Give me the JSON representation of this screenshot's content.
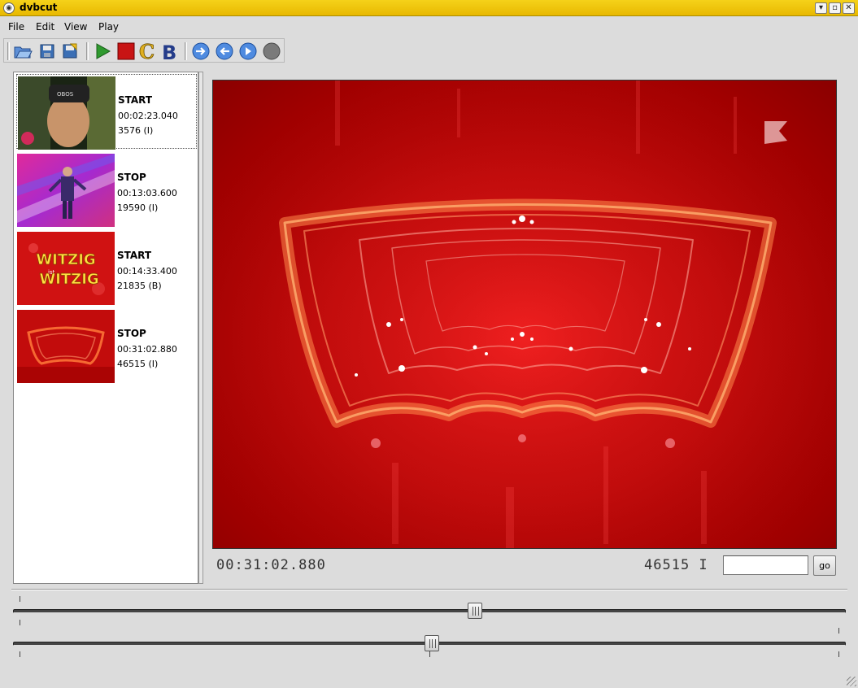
{
  "window": {
    "title": "dvbcut",
    "app_icon": "app-icon",
    "buttons": [
      "minimize-icon",
      "maximize-icon",
      "close-icon"
    ]
  },
  "menubar": {
    "items": [
      {
        "label": "File"
      },
      {
        "label": "Edit"
      },
      {
        "label": "View"
      },
      {
        "label": "Play"
      }
    ]
  },
  "toolbar": {
    "buttons": [
      {
        "name": "open",
        "icon": "open-folder-icon"
      },
      {
        "name": "save",
        "icon": "save-icon"
      },
      {
        "name": "export",
        "icon": "export-icon"
      },
      {
        "name": "play",
        "icon": "play-icon"
      },
      {
        "name": "stop",
        "icon": "stop-icon"
      },
      {
        "name": "chapter",
        "icon": "chapter-c-icon",
        "glyph": "C"
      },
      {
        "name": "bookmark",
        "icon": "bookmark-b-icon",
        "glyph": "B"
      },
      {
        "name": "jump-forward",
        "icon": "arrow-right-circle-icon"
      },
      {
        "name": "jump-back",
        "icon": "arrow-left-circle-icon"
      },
      {
        "name": "next",
        "icon": "triangle-right-circle-icon"
      },
      {
        "name": "record",
        "icon": "gray-circle-icon"
      }
    ]
  },
  "marks": [
    {
      "kind": "START",
      "time": "00:02:23.040",
      "frame": "3576 (I)",
      "selected": true
    },
    {
      "kind": "STOP",
      "time": "00:13:03.600",
      "frame": "19590 (I)",
      "selected": false
    },
    {
      "kind": "START",
      "time": "00:14:33.400",
      "frame": "21835 (B)",
      "selected": false
    },
    {
      "kind": "STOP",
      "time": "00:31:02.880",
      "frame": "46515 (I)",
      "selected": false
    }
  ],
  "thumb3_text": {
    "line1": "WITZIG",
    "line2": "ist",
    "line3": "WITZIG"
  },
  "status": {
    "timecode": "00:31:02.880",
    "frame": "46515 I",
    "go_input_value": "",
    "go_label": "go"
  },
  "sliders": {
    "fine_position": 0.556,
    "coarse_position": 0.503
  },
  "colors": {
    "titlebar": "#e8b800",
    "video_red": "#c50a0a"
  }
}
